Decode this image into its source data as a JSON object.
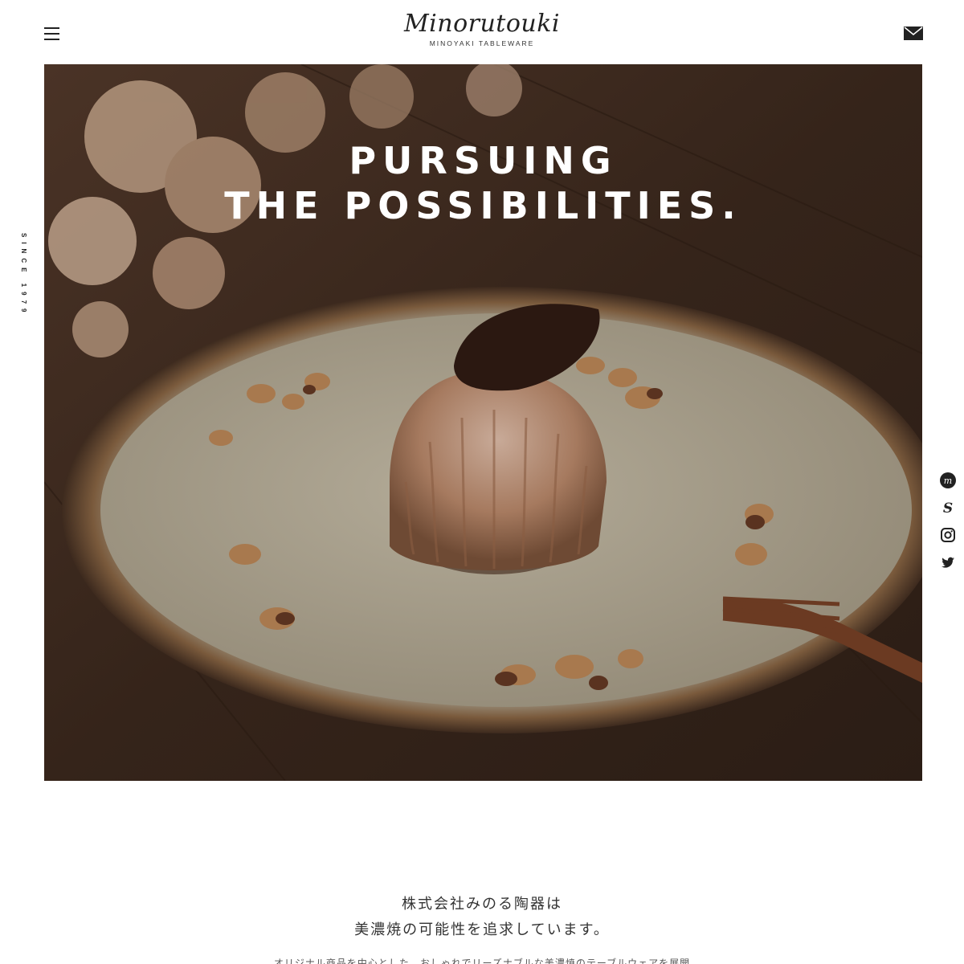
{
  "header": {
    "logo_script": "Minorutouki",
    "logo_sub": "MINOYAKI TABLEWARE"
  },
  "side_text": "SINCE 1979",
  "hero": {
    "title_line1": "PURSUING",
    "title_line2": "THE POSSIBILITIES."
  },
  "icons": {
    "menu": "hamburger-menu-icon",
    "mail": "mail-icon",
    "social": [
      "minne-icon",
      "stores-icon",
      "instagram-icon",
      "twitter-icon"
    ]
  },
  "intro": {
    "line1": "株式会社みのる陶器は",
    "line2": "美濃焼の可能性を追求しています。",
    "body": "オリジナル商品を中心とした、おしゃれでリーズナブルな美濃焼のテーブルウェアを展開"
  },
  "colors": {
    "background": "#ffffff",
    "text": "#222222",
    "hero_wood": "#3a281d",
    "plate": "#a59c89"
  }
}
